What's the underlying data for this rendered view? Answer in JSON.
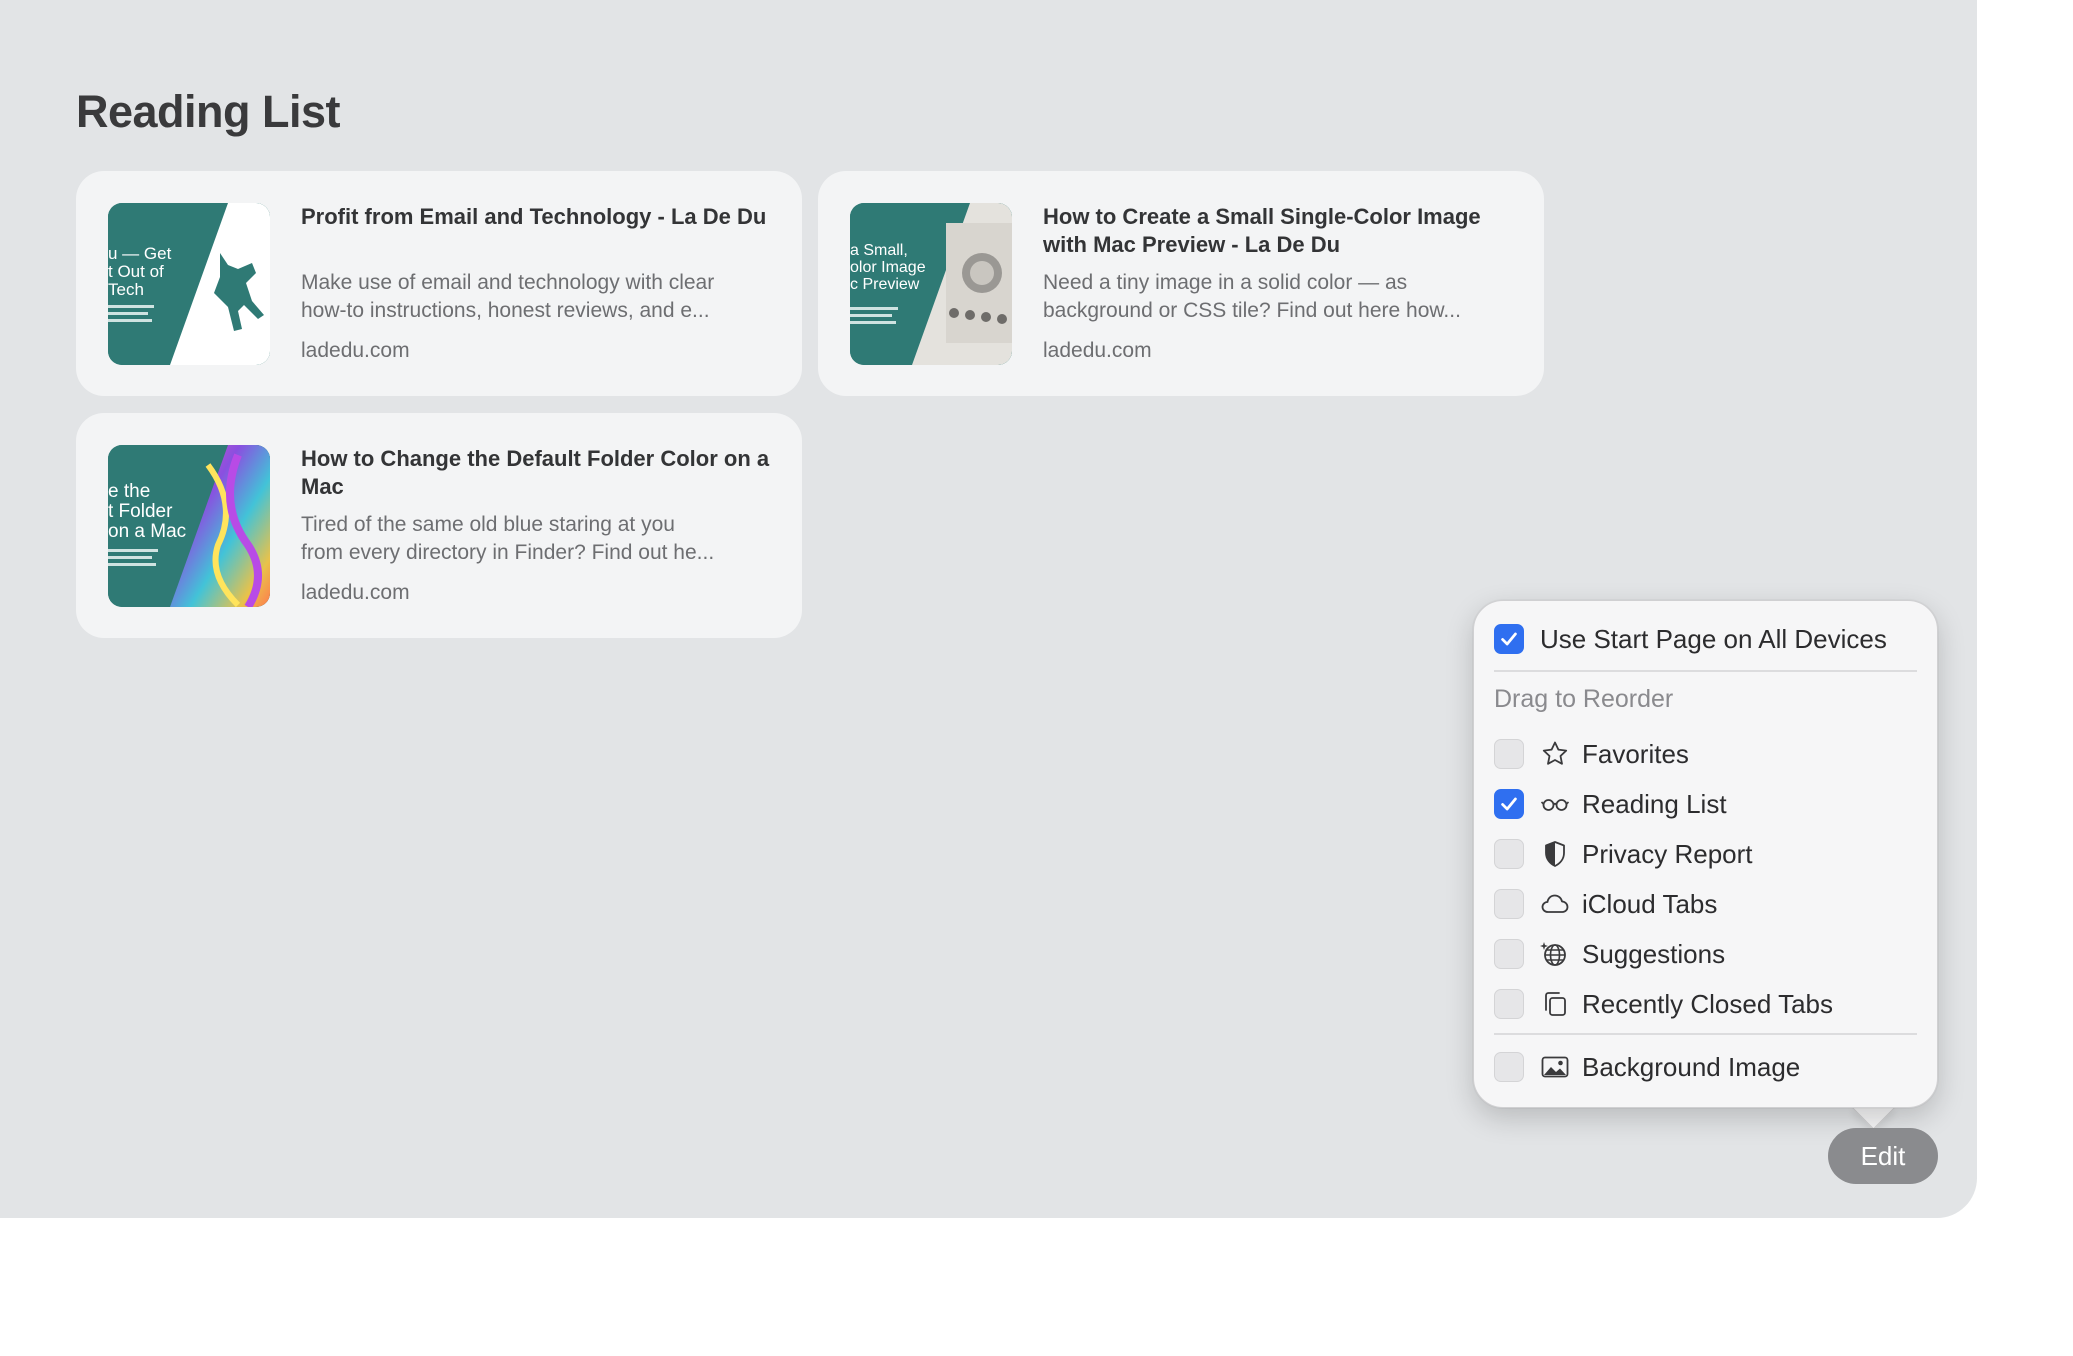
{
  "section": {
    "title": "Reading List"
  },
  "reading_list": [
    {
      "title": "Profit from Email and Technology - La De Du",
      "desc_line1": "Make use of email and technology with clear",
      "desc_line2": "how-to instructions, honest reviews, and e...",
      "domain": "ladedu.com",
      "thumb_lines": [
        "u — Get",
        "t Out of",
        "Tech"
      ]
    },
    {
      "title": "How to Create a Small Single-Color Image with Mac Preview - La De Du",
      "desc_line1": "Need a tiny image in a solid color — as",
      "desc_line2": "background or CSS tile? Find out here how...",
      "domain": "ladedu.com",
      "thumb_lines": [
        "a Small,",
        "olor Image",
        "c Preview"
      ]
    },
    {
      "title": "How to Change the Default Folder Color on a Mac",
      "desc_line1": "Tired of the same old blue staring at you",
      "desc_line2": "from every directory in Finder? Find out he...",
      "domain": "ladedu.com",
      "thumb_lines": [
        "e the",
        "t Folder",
        "on a Mac"
      ]
    }
  ],
  "popover": {
    "all_devices": {
      "label": "Use Start Page on All Devices",
      "checked": true
    },
    "reorder_heading": "Drag to Reorder",
    "sections": [
      {
        "label": "Favorites",
        "icon": "star-icon",
        "checked": false
      },
      {
        "label": "Reading List",
        "icon": "glasses-icon",
        "checked": true
      },
      {
        "label": "Privacy Report",
        "icon": "shield-icon",
        "checked": false
      },
      {
        "label": "iCloud Tabs",
        "icon": "cloud-icon",
        "checked": false
      },
      {
        "label": "Suggestions",
        "icon": "globe-icon",
        "checked": false
      },
      {
        "label": "Recently Closed Tabs",
        "icon": "tabs-icon",
        "checked": false
      }
    ],
    "background_image": {
      "label": "Background Image",
      "icon": "photo-icon",
      "checked": false
    }
  },
  "edit_button": {
    "label": "Edit"
  },
  "colors": {
    "accent": "#2f6ff0",
    "thumb_teal": "#2f7a75",
    "page_background": "#e2e4e6"
  }
}
